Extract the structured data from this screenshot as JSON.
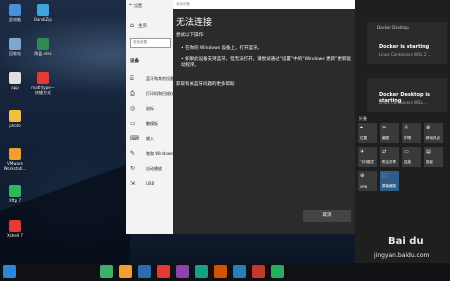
{
  "desktop_icons": [
    {
      "label": "此电脑",
      "color": "#4a90d9"
    },
    {
      "label": "BandiZip",
      "color": "#3ba5e0"
    },
    {
      "label": "回收站",
      "color": "#7fa8d0"
    },
    {
      "label": "陈盈.xlsx",
      "color": "#2e8b57"
    },
    {
      "label": "app",
      "color": "#e0e0e0"
    },
    {
      "label": "mathtype一快捷方式",
      "color": "#e53935"
    },
    {
      "label": "photo",
      "color": "#f0c040"
    },
    {
      "label": "VMware Workstati...",
      "color": "#f0a030"
    },
    {
      "label": "Xftp 7",
      "color": "#2eb85c"
    },
    {
      "label": "Xshell 7",
      "color": "#e53935"
    }
  ],
  "settings": {
    "window_title": "设置",
    "home": "主页",
    "search_placeholder": "查找设置",
    "section": "设备",
    "items": [
      {
        "icon": "bluetooth-icon",
        "glyph": "⌸",
        "label": "蓝牙和其他设备"
      },
      {
        "icon": "printer-icon",
        "glyph": "⎙",
        "label": "打印机和扫描仪"
      },
      {
        "icon": "mouse-icon",
        "glyph": "◎",
        "label": "鼠标"
      },
      {
        "icon": "touchpad-icon",
        "glyph": "▭",
        "label": "触摸板"
      },
      {
        "icon": "keyboard-icon",
        "glyph": "⌨",
        "label": "输入"
      },
      {
        "icon": "pen-icon",
        "glyph": "✎",
        "label": "笔和 Windows Ink"
      },
      {
        "icon": "autoplay-icon",
        "glyph": "↻",
        "label": "自动播放"
      },
      {
        "icon": "usb-icon",
        "glyph": "⇲",
        "label": "USB"
      }
    ]
  },
  "dialog": {
    "header": "添加设备",
    "title": "无法连接",
    "line1": "尝试以下操作:",
    "bullet1": "•  在你的 Windows 设备上，打开蓝牙。",
    "bullet2": "•  如果此设备支持蓝牙，但无法打开，请尝试通过“设置”中的“Windows 更新”更新驱动程序。",
    "link": "获取有关蓝牙问题的更多帮助",
    "cancel": "取消"
  },
  "notifications": [
    {
      "app": "Docker Desktop",
      "title": "Docker is starting",
      "sub": "Linux Containers WSL 2 ...",
      "time": ""
    },
    {
      "app": "",
      "title": "Docker Desktop is starting",
      "sub": "Linux Containers WSL...",
      "time": ""
    }
  ],
  "quick_header": "折叠",
  "quick_tiles": [
    {
      "label": "位置",
      "glyph": "⌖",
      "on": false
    },
    {
      "label": "截图",
      "glyph": "✂",
      "on": false
    },
    {
      "label": "护眼",
      "glyph": "☼",
      "on": false
    },
    {
      "label": "移动热点",
      "glyph": "⊛",
      "on": false
    },
    {
      "label": "飞行模式",
      "glyph": "✈",
      "on": false
    },
    {
      "label": "附近共享",
      "glyph": "⇄",
      "on": false
    },
    {
      "label": "连接",
      "glyph": "▭",
      "on": false
    },
    {
      "label": "投影",
      "glyph": "▤",
      "on": false
    },
    {
      "label": "VPN",
      "glyph": "⊕",
      "on": false
    },
    {
      "label": "屏幕截图",
      "glyph": "⬚",
      "on": true
    }
  ],
  "taskbar": {
    "apps": [
      {
        "name": "start",
        "color": "#2b88d8"
      },
      {
        "name": "search",
        "color": "#0f1115"
      },
      {
        "name": "taskview",
        "color": "#0f1115"
      },
      {
        "name": "app1",
        "color": "#3db06b"
      },
      {
        "name": "app2",
        "color": "#f0a030"
      },
      {
        "name": "app3",
        "color": "#2b6cb0"
      },
      {
        "name": "app4",
        "color": "#e53935"
      },
      {
        "name": "app5",
        "color": "#8e44ad"
      },
      {
        "name": "app6",
        "color": "#16a085"
      },
      {
        "name": "app7",
        "color": "#d35400"
      },
      {
        "name": "app8",
        "color": "#2980b9"
      },
      {
        "name": "app9",
        "color": "#c0392b"
      },
      {
        "name": "app10",
        "color": "#27ae60"
      }
    ],
    "time": "",
    "date": ""
  },
  "watermark": "Bai du",
  "watermark_url": "jingyan.baidu.com"
}
